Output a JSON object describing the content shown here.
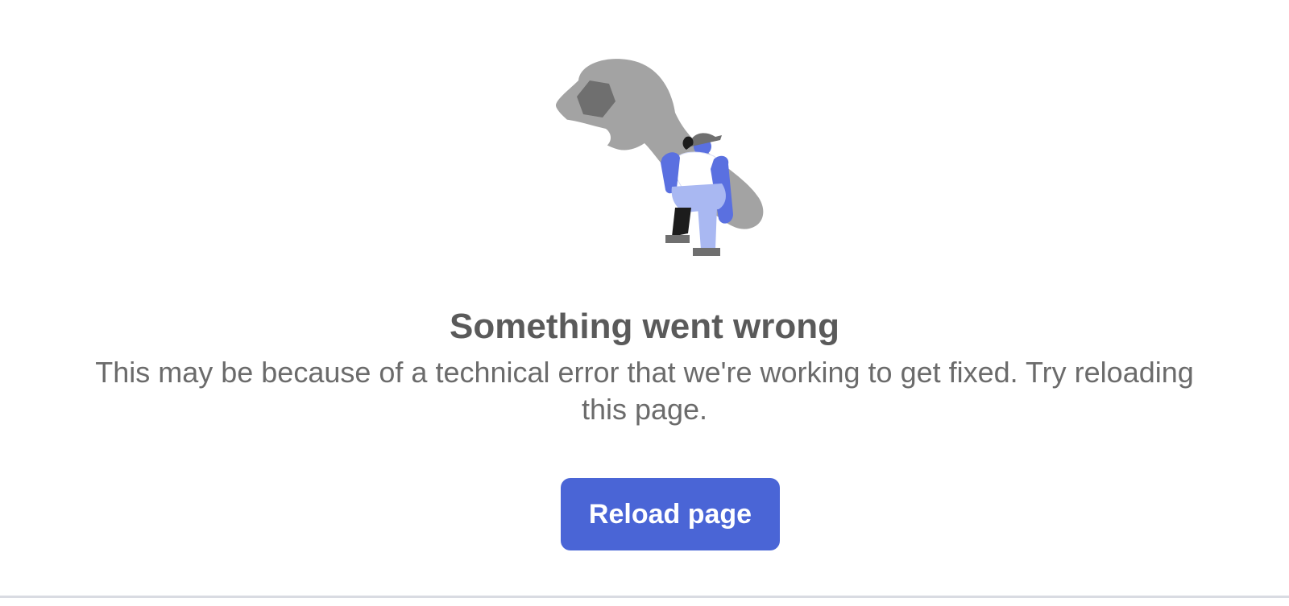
{
  "error": {
    "title": "Something went wrong",
    "message": "This may be because of a technical error that we're working to get fixed. Try reloading this page.",
    "reload_label": "Reload page",
    "illustration_icon": "wrench-worker-icon"
  },
  "colors": {
    "button_bg": "#4a65d6",
    "heading_text": "#5a5a5a",
    "body_text": "#6b6b6b",
    "illustration_primary": "#5a70e0",
    "illustration_light": "#a9b8f2",
    "wrench_gray": "#a3a3a3"
  }
}
